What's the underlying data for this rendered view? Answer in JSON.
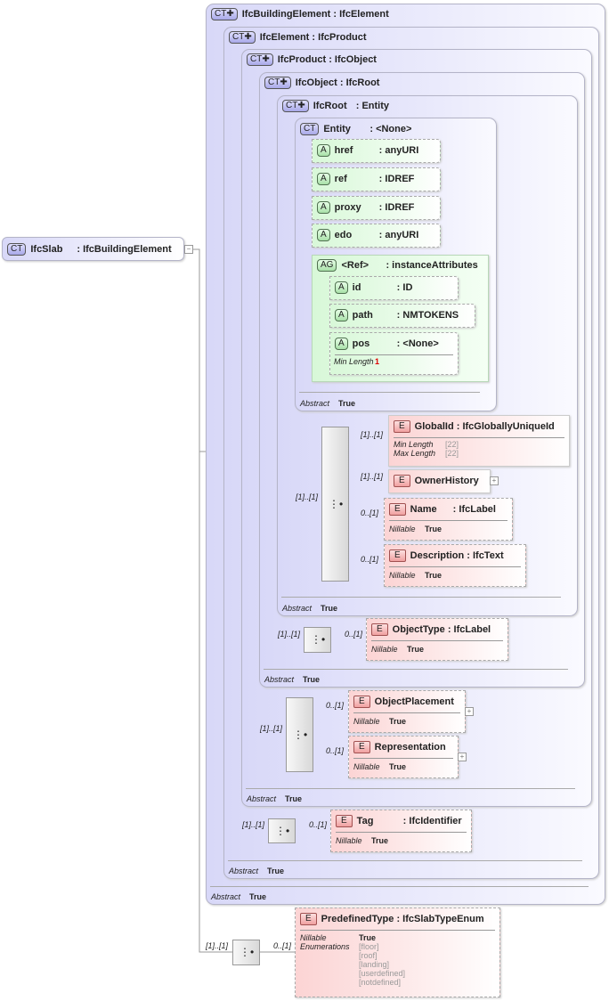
{
  "root": {
    "badge": "CT",
    "name": "IfcSlab",
    "type": ": IfcBuildingElement"
  },
  "types": [
    {
      "badge": "CT",
      "name": "IfcBuildingElement",
      "type": ": IfcElement",
      "abstract_label": "Abstract",
      "abstract_value": "True"
    },
    {
      "badge": "CT",
      "name": "IfcElement",
      "type": ": IfcProduct",
      "abstract_label": "Abstract",
      "abstract_value": "True"
    },
    {
      "badge": "CT",
      "name": "IfcProduct",
      "type": ": IfcObject",
      "abstract_label": "Abstract",
      "abstract_value": "True"
    },
    {
      "badge": "CT",
      "name": "IfcObject",
      "type": ": IfcRoot",
      "abstract_label": "Abstract",
      "abstract_value": "True"
    },
    {
      "badge": "CT",
      "name": "IfcRoot",
      "type": ": Entity",
      "abstract_label": "Abstract",
      "abstract_value": "True"
    },
    {
      "badge": "CT",
      "name": "Entity",
      "type": ": <None>",
      "abstract_label": "Abstract",
      "abstract_value": "True"
    }
  ],
  "attributes": [
    {
      "badge": "A",
      "name": "href",
      "type": ": anyURI"
    },
    {
      "badge": "A",
      "name": "ref",
      "type": ": IDREF"
    },
    {
      "badge": "A",
      "name": "proxy",
      "type": ": IDREF"
    },
    {
      "badge": "A",
      "name": "edo",
      "type": ": anyURI"
    }
  ],
  "attribute_group": {
    "badge": "AG",
    "name": "<Ref>",
    "type": ": instanceAttributes",
    "attributes": [
      {
        "badge": "A",
        "name": "id",
        "type": ": ID"
      },
      {
        "badge": "A",
        "name": "path",
        "type": ": NMTOKENS"
      },
      {
        "badge": "A",
        "name": "pos",
        "type": ": <None>",
        "prop_label": "Min Length",
        "prop_value": "1"
      }
    ]
  },
  "elements": {
    "globalid": {
      "badge": "E",
      "name": "GlobalId",
      "type": ": IfcGloballyUniqueId",
      "card": "[1]..[1]",
      "p1_label": "Min Length",
      "p1_value": "[22]",
      "p2_label": "Max Length",
      "p2_value": "[22]"
    },
    "ownerhistory": {
      "badge": "E",
      "name": "OwnerHistory",
      "card": "[1]..[1]",
      "expand": "+"
    },
    "name": {
      "badge": "E",
      "name": "Name",
      "type": ": IfcLabel",
      "card": "0..[1]",
      "p1_label": "Nillable",
      "p1_value": "True"
    },
    "description": {
      "badge": "E",
      "name": "Description",
      "type": ": IfcText",
      "card": "0..[1]",
      "p1_label": "Nillable",
      "p1_value": "True"
    },
    "objecttype": {
      "badge": "E",
      "name": "ObjectType",
      "type": ": IfcLabel",
      "card": "0..[1]",
      "p1_label": "Nillable",
      "p1_value": "True"
    },
    "objectplacement": {
      "badge": "E",
      "name": "ObjectPlacement",
      "card": "0..[1]",
      "p1_label": "Nillable",
      "p1_value": "True",
      "expand": "+"
    },
    "representation": {
      "badge": "E",
      "name": "Representation",
      "card": "0..[1]",
      "p1_label": "Nillable",
      "p1_value": "True",
      "expand": "+"
    },
    "tag": {
      "badge": "E",
      "name": "Tag",
      "type": ": IfcIdentifier",
      "card": "0..[1]",
      "p1_label": "Nillable",
      "p1_value": "True"
    },
    "predefinedtype": {
      "badge": "E",
      "name": "PredefinedType",
      "type": ": IfcSlabTypeEnum",
      "card": "0..[1]",
      "p1_label": "Nillable",
      "p1_value": "True",
      "p2_label": "Enumerations",
      "enums": [
        "[floor]",
        "[roof]",
        "[landing]",
        "[userdefined]",
        "[notdefined]"
      ]
    }
  },
  "sequences": {
    "ifcroot": "[1]..[1]",
    "ifcobject": "[1]..[1]",
    "ifcproduct": "[1]..[1]",
    "ifcelement": "[1]..[1]",
    "ifcslab": "[1]..[1]"
  },
  "root_expand": "−"
}
